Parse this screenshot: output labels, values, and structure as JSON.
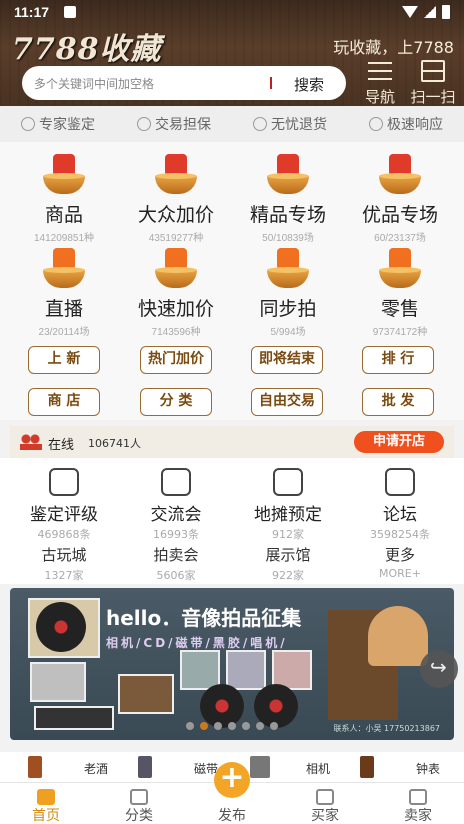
{
  "status_bar": {
    "time": "11:17"
  },
  "header": {
    "logo": "7788收藏",
    "slogan": "玩收藏，上7788",
    "search_placeholder": "多个关键词中间加空格",
    "search_button": "搜索",
    "nav_label": "导航",
    "scan_label": "扫一扫"
  },
  "features": [
    "专家鉴定",
    "交易担保",
    "无忧退货",
    "极速响应"
  ],
  "categories": [
    {
      "name": "商品",
      "sub": "141209851种"
    },
    {
      "name": "大众加价",
      "sub": "43519277种"
    },
    {
      "name": "精品专场",
      "sub": "50/10839场"
    },
    {
      "name": "优品专场",
      "sub": "60/23137场"
    },
    {
      "name": "直播",
      "sub": "23/20114场"
    },
    {
      "name": "快速加价",
      "sub": "7143596种"
    },
    {
      "name": "同步拍",
      "sub": "5/994场"
    },
    {
      "name": "零售",
      "sub": "97374172种"
    }
  ],
  "pills": [
    "上 新",
    "热门加价",
    "即将结束",
    "排 行",
    "商 店",
    "分 类",
    "自由交易",
    "批 发"
  ],
  "online": {
    "label": "在线",
    "count": "106741人",
    "button": "申请开店"
  },
  "services": [
    {
      "name": "鉴定评级",
      "sub": "469868条"
    },
    {
      "name": "交流会",
      "sub": "16993条"
    },
    {
      "name": "地摊预定",
      "sub": "912家"
    },
    {
      "name": "论坛",
      "sub": "3598254条"
    }
  ],
  "services2": [
    {
      "name": "古玩城",
      "sub": "1327家"
    },
    {
      "name": "拍卖会",
      "sub": "5606家"
    },
    {
      "name": "展示馆",
      "sub": "922家"
    },
    {
      "name": "更多",
      "sub": "MORE+"
    }
  ],
  "banner": {
    "title": "hello．音像拍品征集",
    "subtitle": "相机/CD/磁带/黑胶/唱机/",
    "contact": "联系人：小吴 17750213867"
  },
  "strip": [
    "老酒",
    "磁带",
    "相机",
    "钟表"
  ],
  "tabs": [
    "首页",
    "分类",
    "发布",
    "买家",
    "卖家"
  ],
  "colors": {
    "accent": "#f3a525",
    "shop_button": "#f0501e",
    "pill_border": "#9a6a2e"
  }
}
